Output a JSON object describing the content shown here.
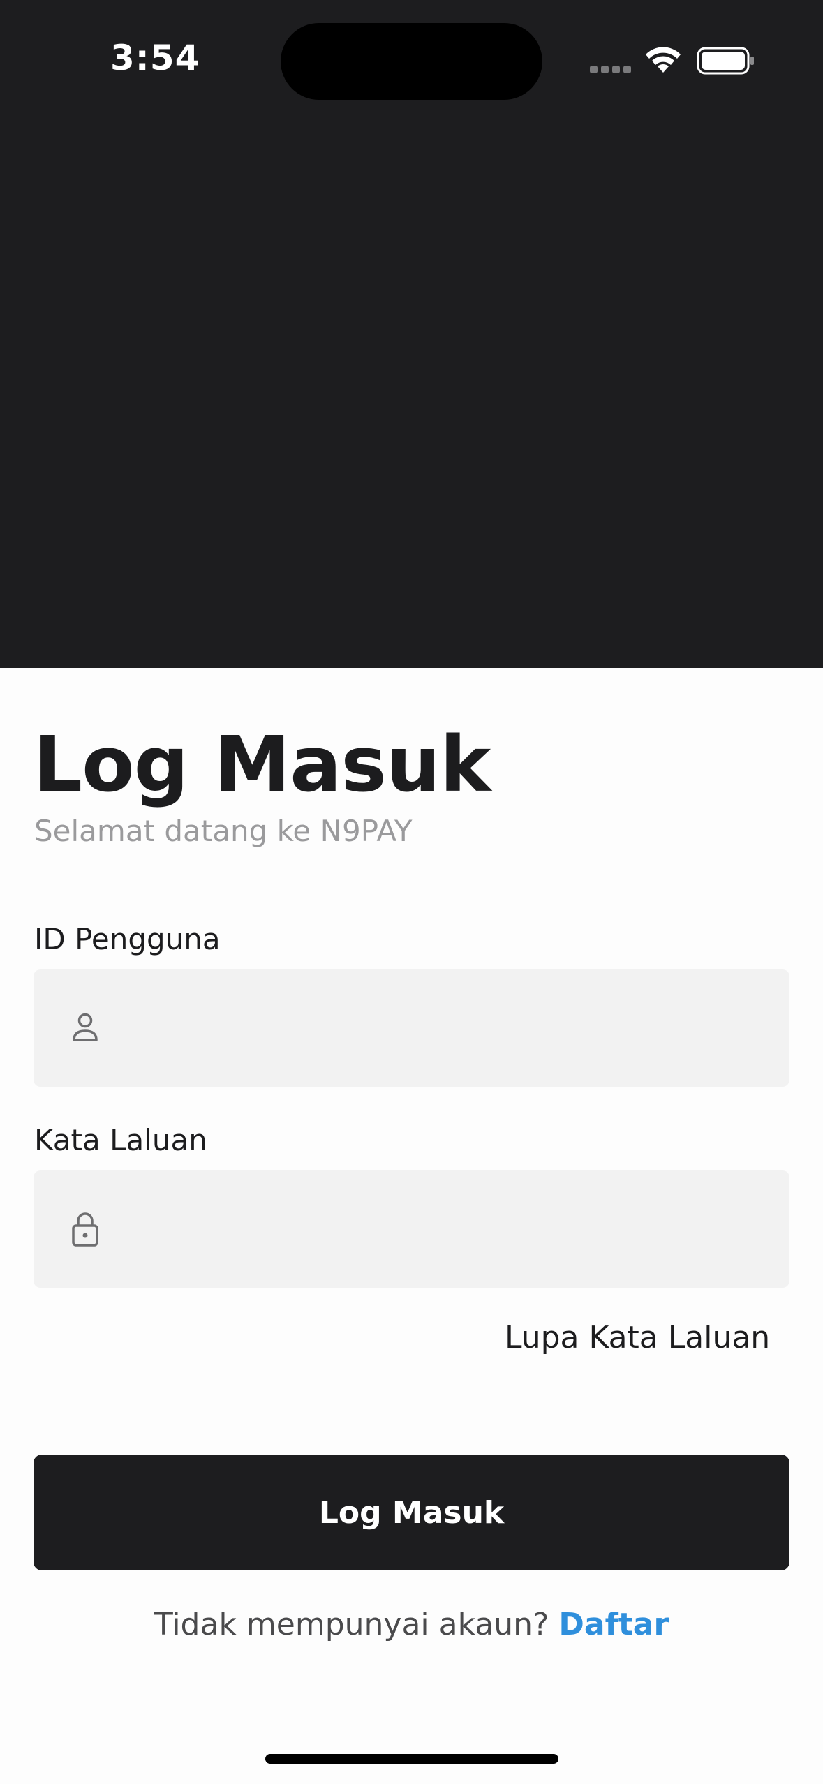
{
  "status_bar": {
    "time": "3:54",
    "icons": [
      "cellular-signal-icon",
      "wifi-icon",
      "battery-icon"
    ]
  },
  "login": {
    "title": "Log Masuk",
    "subtitle": "Selamat datang ke N9PAY",
    "user_id_label": "ID Pengguna",
    "user_id_value": "",
    "user_id_icon": "person-icon",
    "password_label": "Kata Laluan",
    "password_value": "",
    "password_icon": "lock-icon",
    "forgot_password": "Lupa Kata Laluan",
    "submit_label": "Log Masuk",
    "no_account_text": "Tidak mempunyai akaun?",
    "signup_link": "Daftar"
  },
  "colors": {
    "dark": "#1d1d1f",
    "field_bg": "#f2f2f2",
    "muted_text": "#9a9a9c",
    "link": "#2f8fdc"
  }
}
